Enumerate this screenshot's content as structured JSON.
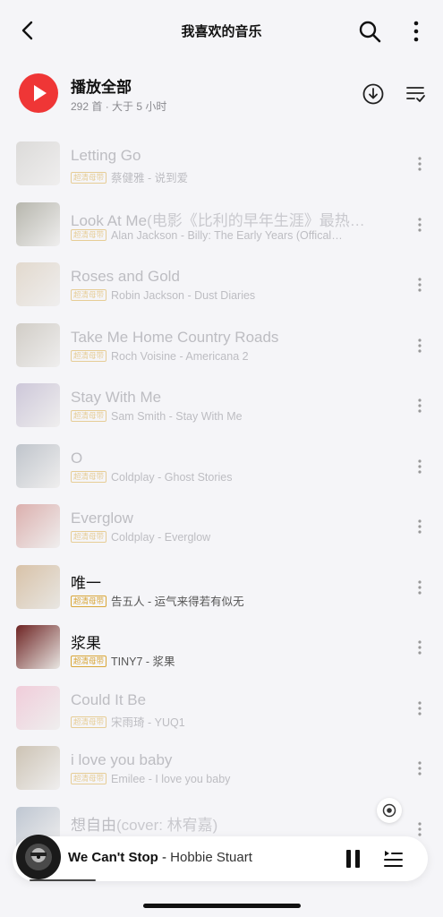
{
  "header": {
    "title": "我喜欢的音乐",
    "icons": [
      "back-arrow-icon",
      "search-icon",
      "more-vertical-icon"
    ]
  },
  "play_all": {
    "label": "播放全部",
    "subtitle": "292 首 · 大于 5 小时",
    "accent": "#ef3636"
  },
  "badge_text": "超清母带",
  "songs": [
    {
      "title": "Letting Go",
      "title_extra": "",
      "meta": "蔡健雅 - 说到爱",
      "dim": true,
      "cover": "#bdbab3"
    },
    {
      "title": "Look At Me",
      "title_extra": "(电影《比利的早年生涯》最热…",
      "meta": "Alan Jackson - Billy: The Early Years (Offical…",
      "dim": true,
      "cover": "#6b6a52"
    },
    {
      "title": "Roses and Gold",
      "title_extra": "",
      "meta": "Robin Jackson - Dust Diaries",
      "dim": true,
      "cover": "#cbb79a"
    },
    {
      "title": "Take Me Home Country Roads",
      "title_extra": "",
      "meta": "Roch Voisine - Americana 2",
      "dim": true,
      "cover": "#a59c8a"
    },
    {
      "title": "Stay With Me",
      "title_extra": "",
      "meta": "Sam Smith - Stay With Me",
      "dim": true,
      "cover": "#9c8fb3"
    },
    {
      "title": "O",
      "title_extra": "",
      "meta": "Coldplay - Ghost Stories",
      "dim": true,
      "cover": "#7e8995"
    },
    {
      "title": "Everglow",
      "title_extra": "",
      "meta": "Coldplay - Everglow",
      "dim": true,
      "cover": "#bc5a52"
    },
    {
      "title": "唯一",
      "title_extra": "",
      "meta": "告五人 - 运气来得若有似无",
      "dim": false,
      "cover": "#d8c2a8"
    },
    {
      "title": "浆果",
      "title_extra": "",
      "meta": "TINY7 - 浆果",
      "dim": false,
      "cover": "#6e2424"
    },
    {
      "title": "Could It Be",
      "title_extra": "",
      "meta": "宋雨琦 - YUQ1",
      "dim": true,
      "cover": "#e99bb5"
    },
    {
      "title": "i love you baby",
      "title_extra": "",
      "meta": "Emilee - I love you baby",
      "dim": true,
      "cover": "#9b8661"
    },
    {
      "title": "想自由",
      "title_extra": "(cover: 林宥嘉)",
      "meta": "",
      "dim": true,
      "cover": "#7d8ea3"
    }
  ],
  "player": {
    "song": "We Can't Stop",
    "separator": " - ",
    "artist": "Hobbie Stuart",
    "progress": 0.16
  }
}
